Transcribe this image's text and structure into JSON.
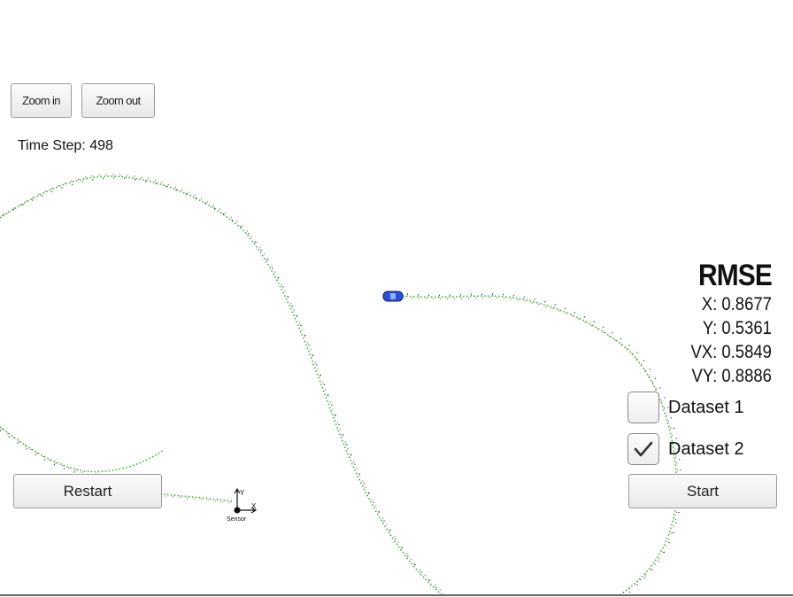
{
  "toolbar": {
    "zoom_in_label": "Zoom in",
    "zoom_out_label": "Zoom out"
  },
  "status": {
    "time_step_label": "Time Step:",
    "time_step_value": "498"
  },
  "rmse": {
    "title": "RMSE",
    "x": "X: 0.8677",
    "y": "Y: 0.5361",
    "vx": "VX: 0.5849",
    "vy": "VY: 0.8886"
  },
  "datasets": [
    {
      "label": "Dataset 1",
      "checked": false
    },
    {
      "label": "Dataset 2",
      "checked": true
    }
  ],
  "controls": {
    "restart_label": "Restart",
    "start_label": "Start"
  },
  "sensor": {
    "label": "Sensor",
    "x_axis": "X",
    "y_axis": "Y"
  },
  "colors": {
    "ground_truth": "#22bb22",
    "lidar": "#e03030",
    "radar": "#2020aa",
    "vehicle": "#2a4fd6"
  },
  "icons": [
    "check-icon",
    "sensor-axes-icon",
    "car-icon"
  ]
}
